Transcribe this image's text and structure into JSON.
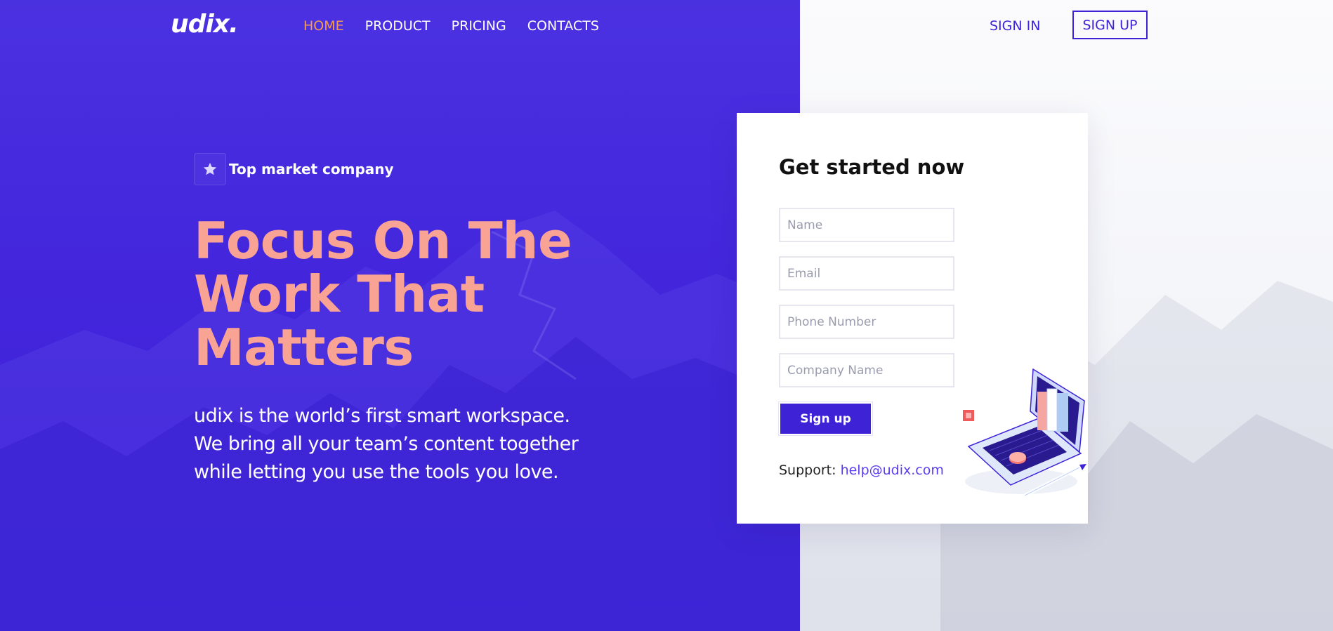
{
  "brand": {
    "logo": "udix."
  },
  "nav": {
    "items": [
      {
        "label": "HOME",
        "active": true
      },
      {
        "label": "PRODUCT",
        "active": false
      },
      {
        "label": "PRICING",
        "active": false
      },
      {
        "label": "CONTACTS",
        "active": false
      }
    ],
    "sign_in": "SIGN IN",
    "sign_up": "SIGN UP"
  },
  "hero": {
    "badge_icon": "star-icon",
    "badge_text": "Top market company",
    "title_lines": [
      "Focus On The",
      "Work That",
      "Matters"
    ],
    "subtitle_lines": [
      "udix is the world’s first smart workspace.",
      "We bring all your team’s content together",
      "while letting you use the tools you love."
    ]
  },
  "form": {
    "title": "Get started now",
    "fields": [
      {
        "placeholder": "Name",
        "value": ""
      },
      {
        "placeholder": "Email",
        "value": ""
      },
      {
        "placeholder": "Phone Number",
        "value": ""
      },
      {
        "placeholder": "Company Name",
        "value": ""
      }
    ],
    "submit_label": "Sign up",
    "support_label": "Support:",
    "support_email": "help@udix.com"
  },
  "colors": {
    "primary": "#3d22d6",
    "accent_orange": "#f49a55",
    "hero_title": "#f8a393",
    "link": "#5b3df0"
  }
}
